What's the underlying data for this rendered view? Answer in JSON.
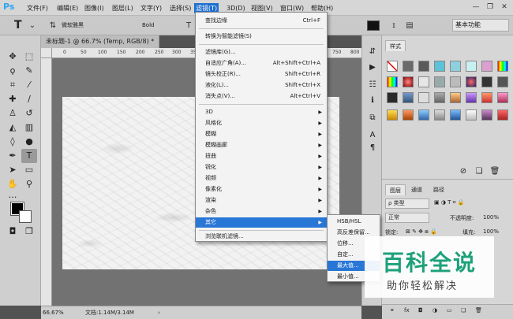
{
  "menubar": {
    "logo": "Ps",
    "items": [
      "文件(F)",
      "编辑(E)",
      "图像(I)",
      "图层(L)",
      "文字(Y)",
      "选择(S)",
      "滤镜(T)",
      "3D(D)",
      "视图(V)",
      "窗口(W)",
      "帮助(H)"
    ],
    "minimize": "—",
    "restore": "❐",
    "close": "✕"
  },
  "options": {
    "tool_glyph": "T",
    "font_family": "微软雅黑",
    "font_style": "Bold",
    "workspace": "基本功能"
  },
  "document": {
    "tab_title": "未标题-1 @ 66.7% (Temp, RGB/8) *",
    "close_glyph": "✕",
    "ruler_ticks": [
      "0",
      "50",
      "100",
      "150",
      "200",
      "250",
      "300",
      "350",
      "400",
      "450",
      "500",
      "550",
      "600",
      "650",
      "700",
      "750",
      "800"
    ],
    "zoom": "66.67%",
    "doc_info": "文档:1.14M/3.14M"
  },
  "filter_menu": {
    "items": [
      {
        "label": "查找边缘",
        "shortcut": "Ctrl+F"
      },
      {
        "label": "转换为智能滤镜(S)",
        "shortcut": ""
      },
      {
        "label": "滤镜库(G)...",
        "shortcut": ""
      },
      {
        "label": "自适应广角(A)...",
        "shortcut": "Alt+Shift+Ctrl+A"
      },
      {
        "label": "镜头校正(R)...",
        "shortcut": "Shift+Ctrl+R"
      },
      {
        "label": "液化(L)...",
        "shortcut": "Shift+Ctrl+X"
      },
      {
        "label": "消失点(V)...",
        "shortcut": "Alt+Ctrl+V"
      },
      {
        "label": "3D",
        "shortcut": ""
      },
      {
        "label": "风格化",
        "shortcut": ""
      },
      {
        "label": "模糊",
        "shortcut": ""
      },
      {
        "label": "模糊画廊",
        "shortcut": ""
      },
      {
        "label": "扭曲",
        "shortcut": ""
      },
      {
        "label": "锐化",
        "shortcut": ""
      },
      {
        "label": "视频",
        "shortcut": ""
      },
      {
        "label": "像素化",
        "shortcut": ""
      },
      {
        "label": "渲染",
        "shortcut": ""
      },
      {
        "label": "杂色",
        "shortcut": ""
      },
      {
        "label": "其它",
        "shortcut": ""
      },
      {
        "label": "浏览联机滤镜...",
        "shortcut": ""
      }
    ],
    "submenu_arrow": "▶"
  },
  "other_submenu": {
    "items": [
      "HSB/HSL",
      "高反差保留...",
      "位移...",
      "自定...",
      "最大值...",
      "最小值..."
    ]
  },
  "styles_panel": {
    "tab": "样式"
  },
  "layers_panel": {
    "tabs": [
      "图层",
      "通道",
      "路径"
    ],
    "kind_filter": "ρ 类型",
    "blend_mode": "正常",
    "opacity_label": "不透明度:",
    "opacity_value": "100%",
    "lock_label": "锁定:",
    "fill_label": "填充:",
    "fill_value": "100%"
  },
  "watermark": {
    "title": "百科全说",
    "subtitle": "助你轻松解决"
  }
}
